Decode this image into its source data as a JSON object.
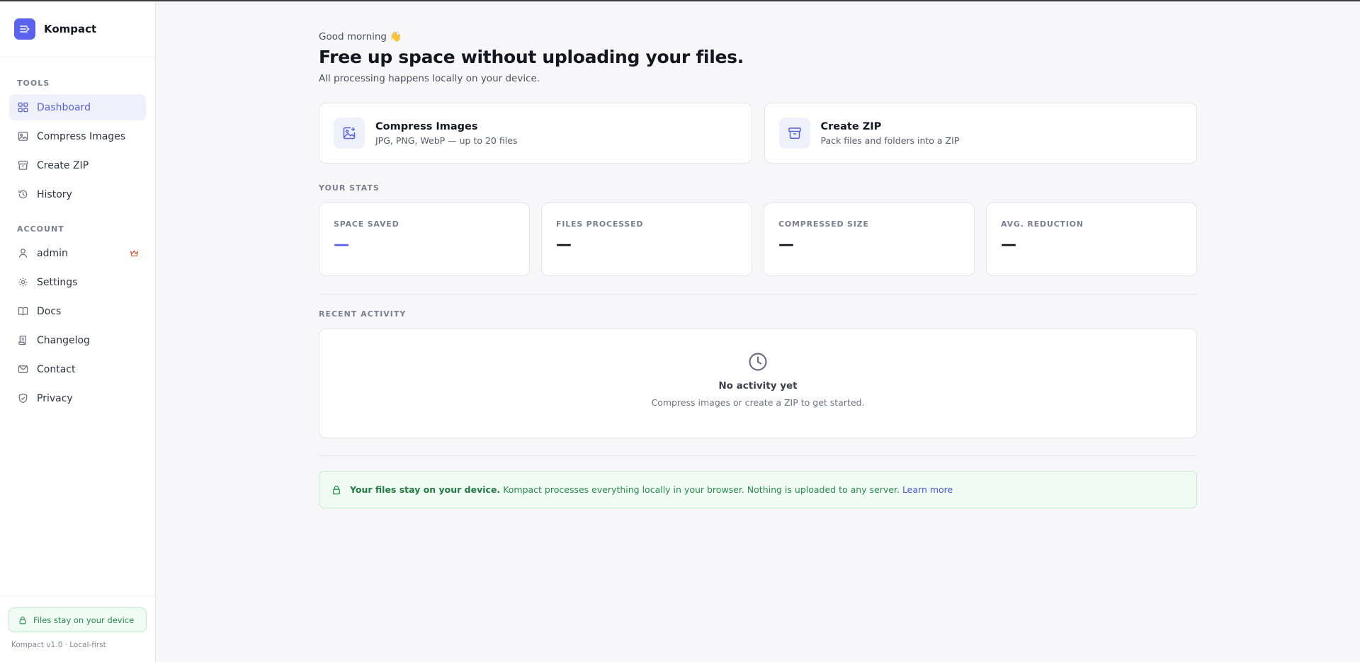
{
  "app": {
    "name": "Kompact",
    "version_note": "Kompact v1.0 · Local-first"
  },
  "sidebar": {
    "tools_label": "TOOLS",
    "account_label": "ACCOUNT",
    "tools": [
      {
        "label": "Dashboard",
        "icon": "dashboard-icon",
        "active": true
      },
      {
        "label": "Compress Images",
        "icon": "image-icon"
      },
      {
        "label": "Create ZIP",
        "icon": "archive-icon"
      },
      {
        "label": "History",
        "icon": "history-icon"
      }
    ],
    "account": [
      {
        "label": "admin",
        "icon": "user-icon",
        "badge": "crown-icon"
      },
      {
        "label": "Settings",
        "icon": "gear-icon"
      },
      {
        "label": "Docs",
        "icon": "book-icon"
      },
      {
        "label": "Changelog",
        "icon": "scroll-icon"
      },
      {
        "label": "Contact",
        "icon": "mail-icon"
      },
      {
        "label": "Privacy",
        "icon": "shield-icon"
      }
    ],
    "safe_pill": "Files stay on your device"
  },
  "header": {
    "greeting": "Good morning 👋",
    "title": "Free up space without uploading your files.",
    "subtitle": "All processing happens locally on your device."
  },
  "tools": [
    {
      "title": "Compress Images",
      "desc": "JPG, PNG, WebP — up to 20 files",
      "icon": "image-plus-icon"
    },
    {
      "title": "Create ZIP",
      "desc": "Pack files and folders into a ZIP",
      "icon": "archive-icon"
    }
  ],
  "stats": {
    "label": "YOUR STATS",
    "items": [
      {
        "title": "SPACE SAVED",
        "value": "—"
      },
      {
        "title": "FILES PROCESSED",
        "value": "—"
      },
      {
        "title": "COMPRESSED SIZE",
        "value": "—"
      },
      {
        "title": "AVG. REDUCTION",
        "value": "—"
      }
    ]
  },
  "activity": {
    "label": "RECENT ACTIVITY",
    "empty_title": "No activity yet",
    "empty_desc": "Compress images or create a ZIP to get started."
  },
  "privacy_banner": {
    "strong": "Your files stay on your device.",
    "text": "Kompact processes everything locally in your browser. Nothing is uploaded to any server.",
    "link": "Learn more"
  },
  "colors": {
    "accent": "#5b63ee",
    "success": "#2b8a4e",
    "success_bg": "#effbf3"
  }
}
